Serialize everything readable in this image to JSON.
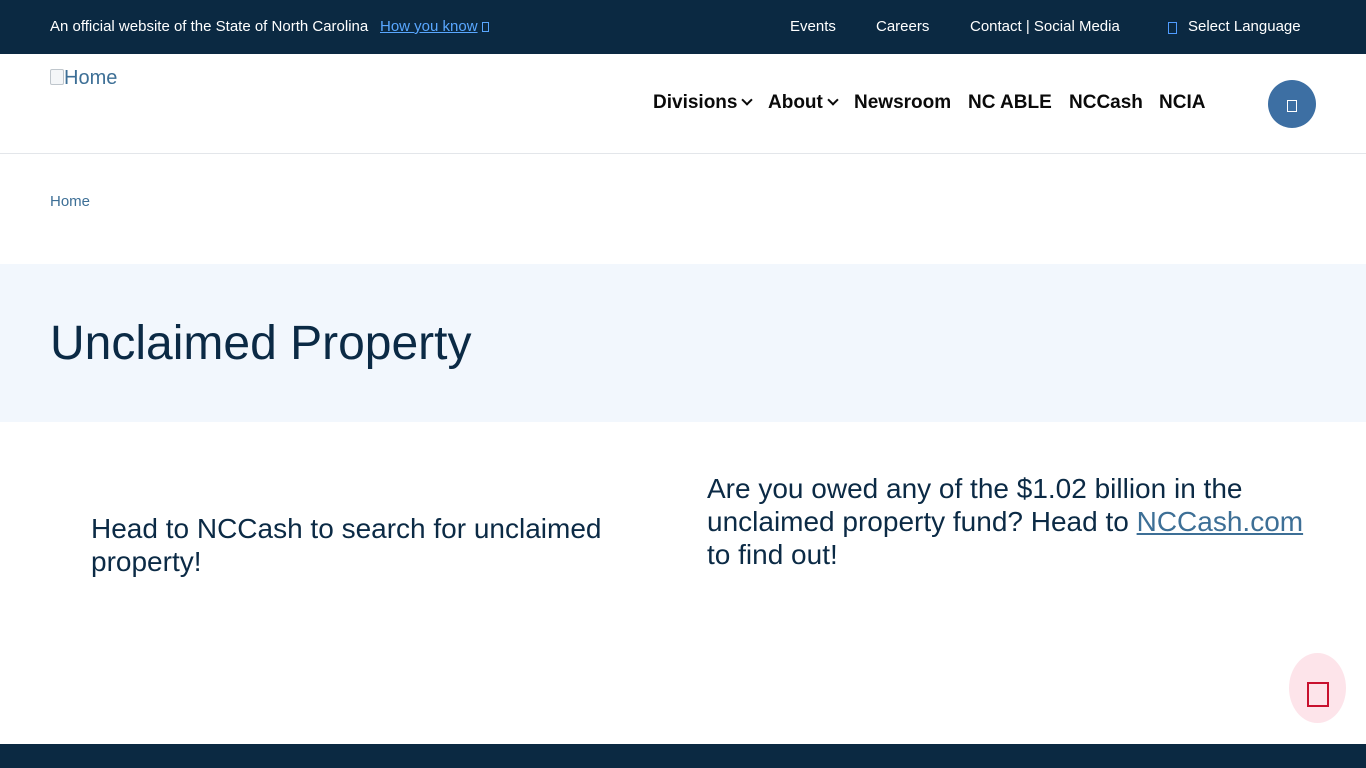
{
  "topbar": {
    "official_text": "An official website of the State of North Carolina",
    "how_you_know": "How you know",
    "links": {
      "events": "Events",
      "careers": "Careers",
      "contact": "Contact | Social Media",
      "language": "Select Language"
    }
  },
  "header": {
    "logo_alt": "Home",
    "nav": {
      "divisions": "Divisions",
      "about": "About",
      "newsroom": "Newsroom",
      "nc_able": "NC ABLE",
      "nccash": "NCCash",
      "ncia": "NCIA"
    }
  },
  "breadcrumb": {
    "home": "Home"
  },
  "hero": {
    "title": "Unclaimed Property"
  },
  "content": {
    "left": "Head to NCCash to search for unclaimed property!",
    "right_before": "Are you owed any of the $1.02 billion in the unclaimed property fund? Head to ",
    "right_link": "NCCash.com",
    "right_after": " to find out!"
  },
  "colors": {
    "navy": "#0b2942",
    "link": "#3d6f96",
    "hero_bg": "#f2f7fd",
    "search_btn": "#3d6fa3",
    "chat_bg": "#fde4ea",
    "chat_icon": "#c8102e"
  },
  "icons": {
    "external_link": "external-link-icon",
    "language": "globe-icon",
    "search": "search-icon",
    "chat": "chat-icon"
  }
}
